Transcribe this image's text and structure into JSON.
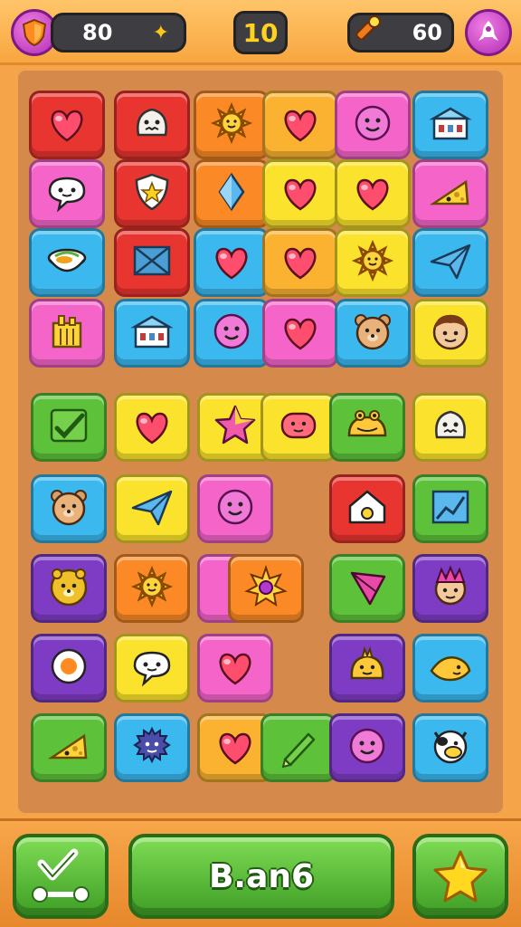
{
  "hud": {
    "left_counter": "80",
    "level": "10",
    "right_counter": "60"
  },
  "buttons": {
    "main_label": "B.an6"
  },
  "colors": {
    "red": "#e8352f",
    "pink": "#f565c9",
    "orange": "#fb8a26",
    "amber": "#fbb230",
    "yellow": "#fbe32d",
    "blue": "#3bb8ee",
    "green": "#5dc23a",
    "purple": "#7e3cc4"
  },
  "tiles": [
    {
      "color": "red",
      "icon": "heart-icon"
    },
    {
      "color": "red",
      "icon": "monster-face-icon"
    },
    {
      "color": "orange",
      "icon": "sun-icon"
    },
    {
      "color": "amber",
      "icon": "heart-icon"
    },
    {
      "color": "pink",
      "icon": "smiley-icon"
    },
    {
      "color": "blue",
      "icon": "building-icon"
    },
    {
      "color": "pink",
      "icon": "speech-bubble-icon"
    },
    {
      "color": "red",
      "icon": "shield-star-icon"
    },
    {
      "color": "orange",
      "icon": "diamond-icon"
    },
    {
      "color": "yellow",
      "icon": "heart-icon"
    },
    {
      "color": "yellow",
      "icon": "heart-icon"
    },
    {
      "color": "pink",
      "icon": "cheese-icon"
    },
    {
      "color": "blue",
      "icon": "bowl-icon"
    },
    {
      "color": "red",
      "icon": "envelope-icon"
    },
    {
      "color": "blue",
      "icon": "heart-icon"
    },
    {
      "color": "amber",
      "icon": "heart-icon"
    },
    {
      "color": "yellow",
      "icon": "sun-icon"
    },
    {
      "color": "blue",
      "icon": "paper-plane-icon"
    },
    {
      "color": "pink",
      "icon": "factory-icon"
    },
    {
      "color": "blue",
      "icon": "building-icon"
    },
    {
      "color": "blue",
      "icon": "smiley-icon"
    },
    {
      "color": "pink",
      "icon": "heart-icon"
    },
    {
      "color": "blue",
      "icon": "bear-face-icon"
    },
    {
      "color": "yellow",
      "icon": "boy-face-icon"
    },
    {
      "color": "green",
      "icon": "check-icon"
    },
    {
      "color": "yellow",
      "icon": "heart-icon"
    },
    {
      "color": "yellow",
      "icon": "star-icon"
    },
    {
      "color": "yellow",
      "icon": "blob-face-icon"
    },
    {
      "color": "green",
      "icon": "frog-face-icon"
    },
    {
      "color": "yellow",
      "icon": "monster-face-icon"
    },
    {
      "color": "blue",
      "icon": "bear-face-icon"
    },
    {
      "color": "yellow",
      "icon": "paper-plane-icon"
    },
    {
      "color": "pink",
      "icon": "smiley-icon"
    },
    {
      "color": "red",
      "icon": "house-icon"
    },
    {
      "color": "green",
      "icon": "chart-icon"
    },
    {
      "color": "purple",
      "icon": "lion-face-icon"
    },
    {
      "color": "orange",
      "icon": "sun-icon"
    },
    {
      "color": "pink",
      "icon": "blank-icon"
    },
    {
      "color": "orange",
      "icon": "gem-icon"
    },
    {
      "color": "green",
      "icon": "kite-icon"
    },
    {
      "color": "purple",
      "icon": "punk-face-icon"
    },
    {
      "color": "purple",
      "icon": "egg-icon"
    },
    {
      "color": "yellow",
      "icon": "speech-bubble-icon"
    },
    {
      "color": "pink",
      "icon": "heart-icon"
    },
    {
      "color": "purple",
      "icon": "chick-face-icon"
    },
    {
      "color": "blue",
      "icon": "fish-icon"
    },
    {
      "color": "green",
      "icon": "cheese-icon"
    },
    {
      "color": "blue",
      "icon": "puffer-face-icon"
    },
    {
      "color": "amber",
      "icon": "heart-icon"
    },
    {
      "color": "green",
      "icon": "pencil-icon"
    },
    {
      "color": "purple",
      "icon": "smiley-icon"
    },
    {
      "color": "blue",
      "icon": "cow-face-icon"
    }
  ]
}
